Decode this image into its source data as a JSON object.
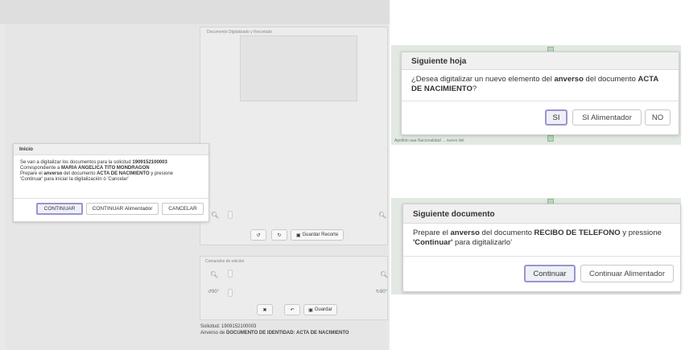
{
  "colors": {
    "accent": "#9c93cf",
    "panel_bg": "#ececec",
    "dialog_bg": "#ffffff"
  },
  "scan_view": {
    "document_panel_title": "Documento Digitalizado y Recortado",
    "crop_toolbar": {
      "rotate_left_icon": "rotate-left",
      "rotate_right_icon": "rotate-right",
      "save_crop_label": "Guardar Recorte"
    },
    "edit_panel_title": "Comandos de edición",
    "edit_toolbar": {
      "zoom_label_right": "90°",
      "rotate_label_left": "90°",
      "save_label": "Guardar"
    },
    "info": {
      "solicitud": "Solicitud: 1909152100003",
      "anverso_prefix": "Anverso de ",
      "anverso_doc": "DOCUMENTO DE IDENTIDAD: ACTA DE NACIMIENTO"
    }
  },
  "inicio_dialog": {
    "title": "Inicio",
    "line1_prefix": "Se van a digitalizar los documentos para la solicitud ",
    "line1_bold": "1909152100003",
    "line2_prefix": "Correspondiente a ",
    "line2_bold": "MARIA ANGELICA TITO MONDRAGON",
    "line3_a": "Prepare el ",
    "line3_b": "anverso",
    "line3_c": " del documento ",
    "line3_d": "ACTA DE NACIMIENTO",
    "line3_e": " y presione",
    "line4": "'Continuar' para iniciar la digitalización ó 'Cancelar'",
    "buttons": {
      "continue": "CONTINUAR",
      "continue_feeder": "CONTINUAR Alimentador",
      "cancel": "CANCELAR"
    }
  },
  "siguiente_hoja_dialog": {
    "title": "Siguiente hoja",
    "text_a": "¿Desea digitalizar un nuevo elemento del ",
    "text_b": "anverso",
    "text_c": " del documento ",
    "text_d": "ACTA",
    "text_e": "DE NACIMIENTO",
    "text_f": "?",
    "buttons": {
      "yes": "SI",
      "yes_feeder": "SI Alimentador",
      "no": "NO"
    },
    "background_strip_text": "Apellido  aaa  Nacionalidad  ... nuevo del"
  },
  "siguiente_documento_dialog": {
    "title": "Siguiente documento",
    "text_a": "Prepare el ",
    "text_b": "anverso",
    "text_c": " del documento ",
    "text_d": "RECIBO DE TELEFONO",
    "text_e": " y pressione",
    "text_f": "'Continuar'",
    "text_g": " para digitalizarlo'",
    "buttons": {
      "continue": "Continuar",
      "continue_feeder": "Continuar Alimentador"
    }
  }
}
